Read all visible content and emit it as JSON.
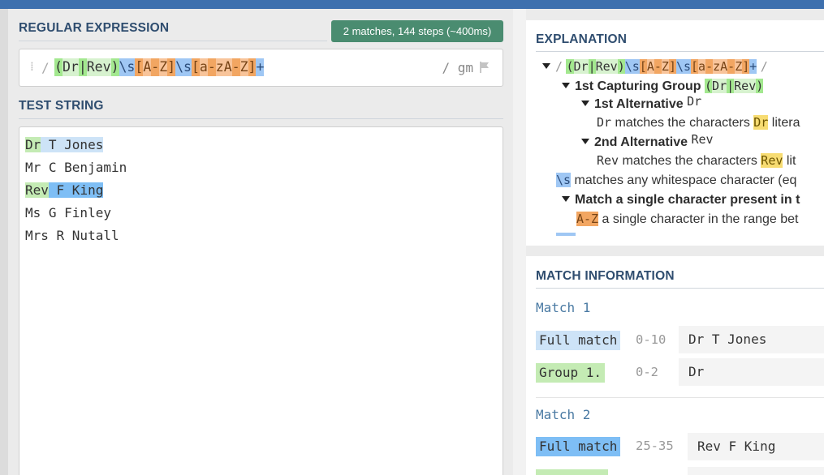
{
  "regex": {
    "heading": "REGULAR EXPRESSION",
    "badge": "2 matches, 144 steps (~400ms)",
    "delimiter_open": "/",
    "delimiter_close_flags": "/ gm",
    "tokens": [
      "(",
      "Dr",
      "|",
      "Rev",
      ")",
      "\\s",
      "[",
      "A",
      "-",
      "Z",
      "]",
      "\\s",
      "[",
      "a",
      "-",
      "z",
      "A",
      "-",
      "Z",
      "]",
      "+"
    ]
  },
  "test_string": {
    "heading": "TEST STRING",
    "lines": [
      "Dr T Jones",
      "Mr C Benjamin",
      "Rev F King",
      "Ms G Finley",
      "Mrs R Nutall"
    ]
  },
  "explanation": {
    "heading": "EXPLANATION",
    "root_open": "/",
    "root_close": "/",
    "root_regex": "(Dr|Rev)\\s[A-Z]\\s[a-zA-Z]+",
    "group1_title": "1st Capturing Group",
    "group1_code": "(Dr|Rev)",
    "alt1_title": "1st Alternative",
    "alt1_code": "Dr",
    "alt1_desc_code": "Dr",
    "alt1_desc_text": "matches the characters",
    "alt1_desc_lit": "Dr",
    "alt1_desc_tail": "litera",
    "alt2_title": "2nd Alternative",
    "alt2_code": "Rev",
    "alt2_desc_code": "Rev",
    "alt2_desc_text": "matches the characters",
    "alt2_desc_lit": "Rev",
    "alt2_desc_tail": "lit",
    "ws_code": "\\s",
    "ws_text": "matches any whitespace character (eq",
    "set_title": "Match a single character present in t",
    "range_code": "A-Z",
    "range_text": "a single character in the range bet"
  },
  "match_info": {
    "heading": "MATCH INFORMATION",
    "matches": [
      {
        "label": "Match 1",
        "full_label": "Full match",
        "full_range": "0-10",
        "full_value": "Dr T Jones",
        "group_label": "Group 1.",
        "group_range": "0-2",
        "group_value": "Dr"
      },
      {
        "label": "Match 2",
        "full_label": "Full match",
        "full_range": "25-35",
        "full_value": "Rev F King"
      }
    ]
  },
  "colors": {
    "topbar": "#3e70ae",
    "heading": "#2f4d6f",
    "badge": "#4a8c70",
    "group": "#a3e88f",
    "whitespace": "#9fc7f4",
    "class": "#f2a662",
    "full_match_1": "#cde3f7",
    "full_match_2": "#7ebef5"
  },
  "icons": [
    "grip-icon",
    "flag-icon",
    "collapse-triangle-icon"
  ]
}
